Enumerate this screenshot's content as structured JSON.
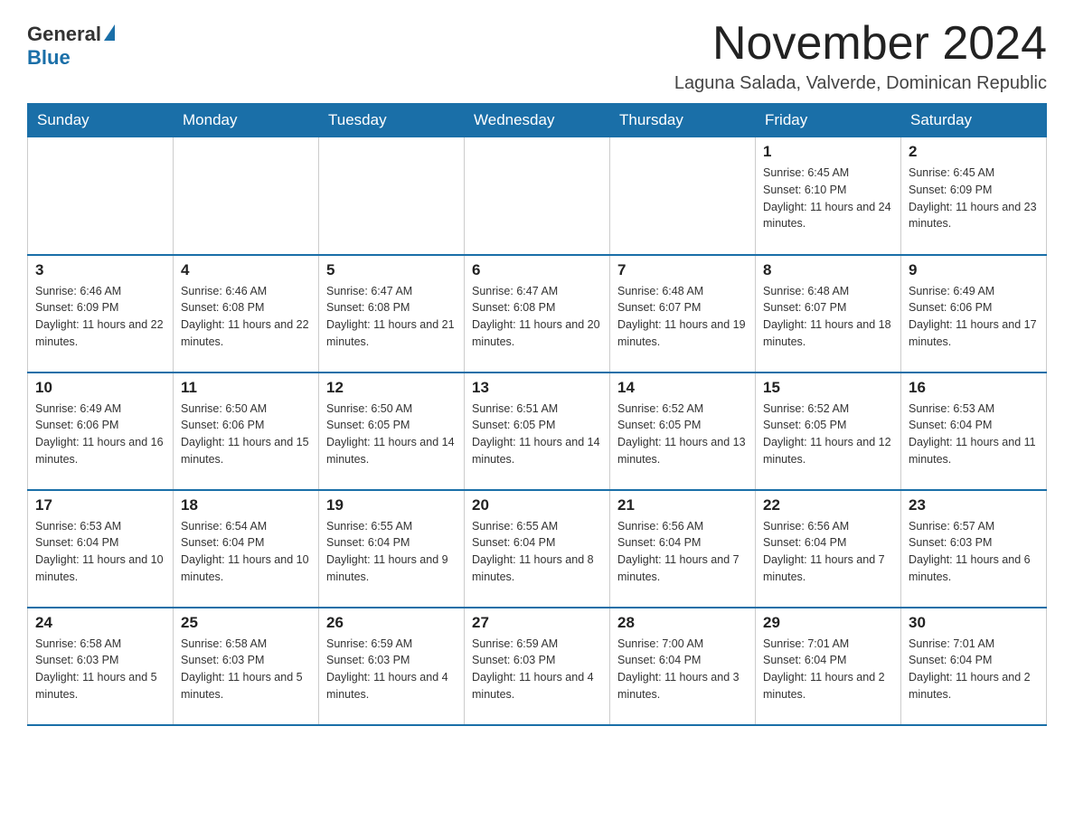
{
  "header": {
    "logo_general": "General",
    "logo_blue": "Blue",
    "month_title": "November 2024",
    "location": "Laguna Salada, Valverde, Dominican Republic"
  },
  "weekdays": [
    "Sunday",
    "Monday",
    "Tuesday",
    "Wednesday",
    "Thursday",
    "Friday",
    "Saturday"
  ],
  "weeks": [
    [
      {
        "day": "",
        "sunrise": "",
        "sunset": "",
        "daylight": ""
      },
      {
        "day": "",
        "sunrise": "",
        "sunset": "",
        "daylight": ""
      },
      {
        "day": "",
        "sunrise": "",
        "sunset": "",
        "daylight": ""
      },
      {
        "day": "",
        "sunrise": "",
        "sunset": "",
        "daylight": ""
      },
      {
        "day": "",
        "sunrise": "",
        "sunset": "",
        "daylight": ""
      },
      {
        "day": "1",
        "sunrise": "Sunrise: 6:45 AM",
        "sunset": "Sunset: 6:10 PM",
        "daylight": "Daylight: 11 hours and 24 minutes."
      },
      {
        "day": "2",
        "sunrise": "Sunrise: 6:45 AM",
        "sunset": "Sunset: 6:09 PM",
        "daylight": "Daylight: 11 hours and 23 minutes."
      }
    ],
    [
      {
        "day": "3",
        "sunrise": "Sunrise: 6:46 AM",
        "sunset": "Sunset: 6:09 PM",
        "daylight": "Daylight: 11 hours and 22 minutes."
      },
      {
        "day": "4",
        "sunrise": "Sunrise: 6:46 AM",
        "sunset": "Sunset: 6:08 PM",
        "daylight": "Daylight: 11 hours and 22 minutes."
      },
      {
        "day": "5",
        "sunrise": "Sunrise: 6:47 AM",
        "sunset": "Sunset: 6:08 PM",
        "daylight": "Daylight: 11 hours and 21 minutes."
      },
      {
        "day": "6",
        "sunrise": "Sunrise: 6:47 AM",
        "sunset": "Sunset: 6:08 PM",
        "daylight": "Daylight: 11 hours and 20 minutes."
      },
      {
        "day": "7",
        "sunrise": "Sunrise: 6:48 AM",
        "sunset": "Sunset: 6:07 PM",
        "daylight": "Daylight: 11 hours and 19 minutes."
      },
      {
        "day": "8",
        "sunrise": "Sunrise: 6:48 AM",
        "sunset": "Sunset: 6:07 PM",
        "daylight": "Daylight: 11 hours and 18 minutes."
      },
      {
        "day": "9",
        "sunrise": "Sunrise: 6:49 AM",
        "sunset": "Sunset: 6:06 PM",
        "daylight": "Daylight: 11 hours and 17 minutes."
      }
    ],
    [
      {
        "day": "10",
        "sunrise": "Sunrise: 6:49 AM",
        "sunset": "Sunset: 6:06 PM",
        "daylight": "Daylight: 11 hours and 16 minutes."
      },
      {
        "day": "11",
        "sunrise": "Sunrise: 6:50 AM",
        "sunset": "Sunset: 6:06 PM",
        "daylight": "Daylight: 11 hours and 15 minutes."
      },
      {
        "day": "12",
        "sunrise": "Sunrise: 6:50 AM",
        "sunset": "Sunset: 6:05 PM",
        "daylight": "Daylight: 11 hours and 14 minutes."
      },
      {
        "day": "13",
        "sunrise": "Sunrise: 6:51 AM",
        "sunset": "Sunset: 6:05 PM",
        "daylight": "Daylight: 11 hours and 14 minutes."
      },
      {
        "day": "14",
        "sunrise": "Sunrise: 6:52 AM",
        "sunset": "Sunset: 6:05 PM",
        "daylight": "Daylight: 11 hours and 13 minutes."
      },
      {
        "day": "15",
        "sunrise": "Sunrise: 6:52 AM",
        "sunset": "Sunset: 6:05 PM",
        "daylight": "Daylight: 11 hours and 12 minutes."
      },
      {
        "day": "16",
        "sunrise": "Sunrise: 6:53 AM",
        "sunset": "Sunset: 6:04 PM",
        "daylight": "Daylight: 11 hours and 11 minutes."
      }
    ],
    [
      {
        "day": "17",
        "sunrise": "Sunrise: 6:53 AM",
        "sunset": "Sunset: 6:04 PM",
        "daylight": "Daylight: 11 hours and 10 minutes."
      },
      {
        "day": "18",
        "sunrise": "Sunrise: 6:54 AM",
        "sunset": "Sunset: 6:04 PM",
        "daylight": "Daylight: 11 hours and 10 minutes."
      },
      {
        "day": "19",
        "sunrise": "Sunrise: 6:55 AM",
        "sunset": "Sunset: 6:04 PM",
        "daylight": "Daylight: 11 hours and 9 minutes."
      },
      {
        "day": "20",
        "sunrise": "Sunrise: 6:55 AM",
        "sunset": "Sunset: 6:04 PM",
        "daylight": "Daylight: 11 hours and 8 minutes."
      },
      {
        "day": "21",
        "sunrise": "Sunrise: 6:56 AM",
        "sunset": "Sunset: 6:04 PM",
        "daylight": "Daylight: 11 hours and 7 minutes."
      },
      {
        "day": "22",
        "sunrise": "Sunrise: 6:56 AM",
        "sunset": "Sunset: 6:04 PM",
        "daylight": "Daylight: 11 hours and 7 minutes."
      },
      {
        "day": "23",
        "sunrise": "Sunrise: 6:57 AM",
        "sunset": "Sunset: 6:03 PM",
        "daylight": "Daylight: 11 hours and 6 minutes."
      }
    ],
    [
      {
        "day": "24",
        "sunrise": "Sunrise: 6:58 AM",
        "sunset": "Sunset: 6:03 PM",
        "daylight": "Daylight: 11 hours and 5 minutes."
      },
      {
        "day": "25",
        "sunrise": "Sunrise: 6:58 AM",
        "sunset": "Sunset: 6:03 PM",
        "daylight": "Daylight: 11 hours and 5 minutes."
      },
      {
        "day": "26",
        "sunrise": "Sunrise: 6:59 AM",
        "sunset": "Sunset: 6:03 PM",
        "daylight": "Daylight: 11 hours and 4 minutes."
      },
      {
        "day": "27",
        "sunrise": "Sunrise: 6:59 AM",
        "sunset": "Sunset: 6:03 PM",
        "daylight": "Daylight: 11 hours and 4 minutes."
      },
      {
        "day": "28",
        "sunrise": "Sunrise: 7:00 AM",
        "sunset": "Sunset: 6:04 PM",
        "daylight": "Daylight: 11 hours and 3 minutes."
      },
      {
        "day": "29",
        "sunrise": "Sunrise: 7:01 AM",
        "sunset": "Sunset: 6:04 PM",
        "daylight": "Daylight: 11 hours and 2 minutes."
      },
      {
        "day": "30",
        "sunrise": "Sunrise: 7:01 AM",
        "sunset": "Sunset: 6:04 PM",
        "daylight": "Daylight: 11 hours and 2 minutes."
      }
    ]
  ]
}
